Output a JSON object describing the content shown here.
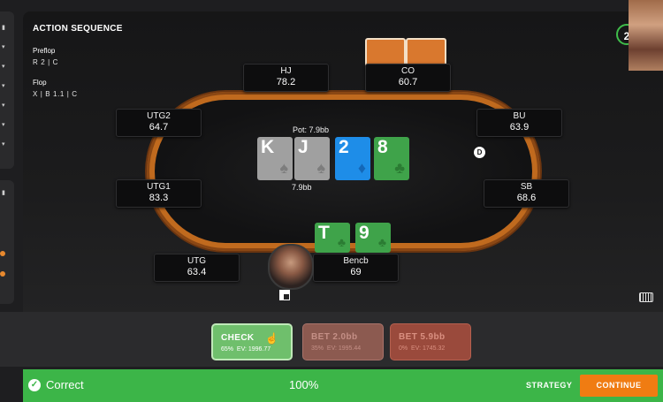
{
  "sequence": {
    "title": "ACTION SEQUENCE",
    "streets": [
      {
        "label": "Preflop",
        "actions": "R 2 | C"
      },
      {
        "label": "Flop",
        "actions": "X | B 1.1 | C"
      }
    ]
  },
  "seats": {
    "hj": {
      "position": "HJ",
      "stack": "78.2"
    },
    "co": {
      "position": "CO",
      "stack": "60.7"
    },
    "utg2": {
      "position": "UTG2",
      "stack": "64.7"
    },
    "bu": {
      "position": "BU",
      "stack": "63.9"
    },
    "utg1": {
      "position": "UTG1",
      "stack": "83.3"
    },
    "sb": {
      "position": "SB",
      "stack": "68.6"
    },
    "utg": {
      "position": "UTG",
      "stack": "63.4"
    },
    "hero": {
      "position": "Bencb",
      "stack": "69"
    }
  },
  "board": {
    "pot_label": "Pot: 7.9bb",
    "pot_amount": "7.9bb",
    "cards": [
      {
        "rank": "K",
        "suit": "spade",
        "color": "#a0a0a0"
      },
      {
        "rank": "J",
        "suit": "spade",
        "color": "#a0a0a0"
      },
      {
        "rank": "2",
        "suit": "diamond",
        "color": "#1e8de8"
      },
      {
        "rank": "8",
        "suit": "club",
        "color": "#3fa34a"
      }
    ]
  },
  "hero_cards": [
    {
      "rank": "T",
      "suit": "club",
      "color": "#3fa34a"
    },
    {
      "rank": "9",
      "suit": "club",
      "color": "#3fa34a"
    }
  ],
  "dealer_button": "D",
  "timer": "2",
  "actions": [
    {
      "label": "CHECK",
      "freq": "65%",
      "ev": "EV: 1996.77"
    },
    {
      "label": "BET 2.0bb",
      "freq": "35%",
      "ev": "EV: 1995.44"
    },
    {
      "label": "BET 5.9bb",
      "freq": "0%",
      "ev": "EV: 1745.32"
    }
  ],
  "result": {
    "status": "Correct",
    "score": "100%",
    "strategy_label": "STRATEGY",
    "continue_label": "CONTINUE"
  },
  "icons": {
    "spade": "♠",
    "club": "♣",
    "diamond": "♦",
    "check": "✓"
  }
}
